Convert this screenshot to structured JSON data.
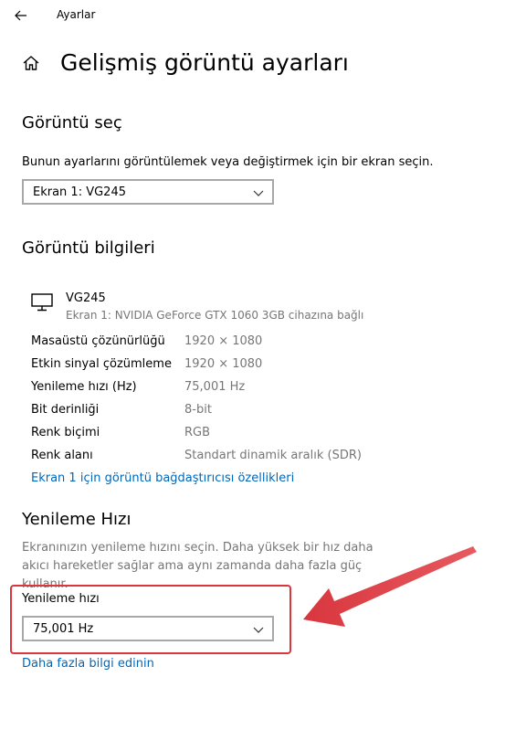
{
  "window": {
    "app_title": "Ayarlar",
    "back_icon": "arrow-left-icon"
  },
  "header": {
    "home_icon": "home-icon",
    "title": "Gelişmiş görüntü ayarları"
  },
  "select_display": {
    "title": "Görüntü seç",
    "description": "Bunun ayarlarını görüntülemek veya değiştirmek için bir ekran seçin.",
    "selected": "Ekran 1: VG245"
  },
  "display_info": {
    "title": "Görüntü bilgileri",
    "monitor_name": "VG245",
    "monitor_subtitle": "Ekran 1: NVIDIA GeForce GTX 1060 3GB cihazına bağlı",
    "rows": [
      {
        "label": "Masaüstü çözünürlüğü",
        "value": "1920 × 1080"
      },
      {
        "label": "Etkin sinyal çözümleme",
        "value": "1920 × 1080"
      },
      {
        "label": "Yenileme hızı (Hz)",
        "value": "75,001 Hz"
      },
      {
        "label": "Bit derinliği",
        "value": "8-bit"
      },
      {
        "label": "Renk biçimi",
        "value": "RGB"
      },
      {
        "label": "Renk alanı",
        "value": "Standart dinamik aralık (SDR)"
      }
    ],
    "adapter_link": "Ekran 1 için görüntü bağdaştırıcısı özellikleri"
  },
  "refresh_rate": {
    "title": "Yenileme Hızı",
    "description": "Ekranınızın yenileme hızını seçin. Daha yüksek bir hız daha akıcı hareketler sağlar ama aynı zamanda daha fazla güç kullanır.",
    "field_label": "Yenileme hızı",
    "selected": "75,001 Hz",
    "more_info_link": "Daha fazla bilgi edinin"
  },
  "colors": {
    "link": "#0067b8",
    "secondary_text": "#767676",
    "annotation_red": "#d9363e"
  }
}
